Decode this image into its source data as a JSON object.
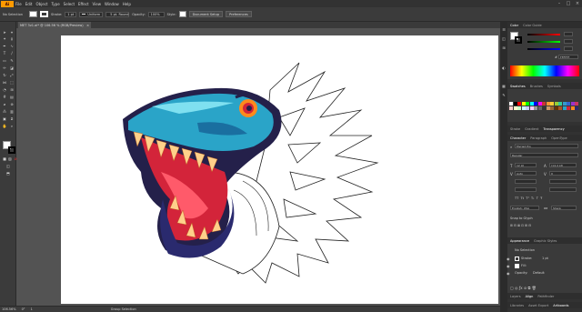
{
  "menubar": {
    "logo": "Ai",
    "items": [
      "File",
      "Edit",
      "Object",
      "Type",
      "Select",
      "Effect",
      "View",
      "Window",
      "Help"
    ]
  },
  "control_bar": {
    "selection": "No Selection",
    "stroke_label": "Stroke:",
    "stroke_value": "1 pt",
    "brush_profile": "Uniform",
    "brush_def": "5 pt. Round",
    "opacity_label": "Opacity:",
    "opacity_value": "100%",
    "style_label": "Style:",
    "document_setup": "Document Setup",
    "preferences": "Preferences"
  },
  "document_tab": {
    "title": "MET 3v1.ai* @ 106.56 % (RGB/Preview)",
    "close": "×"
  },
  "status_bar": {
    "zoom": "106.56%",
    "rotate": "0°",
    "artboard": "1",
    "tool": "Group Selection"
  },
  "color_panel": {
    "tabs": [
      "Color",
      "Color Guide"
    ],
    "hex": "FFFFFF"
  },
  "swatches_panel": {
    "tabs": [
      "Swatches",
      "Brushes",
      "Symbols"
    ]
  },
  "stroke_panel": {
    "tabs": [
      "Stroke",
      "Gradient",
      "Transparency"
    ]
  },
  "character_panel": {
    "tabs": [
      "Character",
      "Paragraph",
      "OpenType"
    ],
    "font": "Myriad Pro",
    "style": "Regular",
    "size": "12 pt",
    "leading": "(14.4 pt)",
    "kerning": "Auto",
    "tracking": "0",
    "language": "English: USA",
    "aa": "Sharp",
    "snap": "Snap to Glyph"
  },
  "appearance_panel": {
    "tabs": [
      "Appearance",
      "Graphic Styles"
    ],
    "no_selection": "No Selection",
    "stroke_label": "Stroke:",
    "stroke_value": "1 pt",
    "fill_label": "Fill:",
    "opacity_label": "Opacity:",
    "opacity_value": "Default"
  },
  "bottom_tabs": {
    "row1": [
      "Layers",
      "Align",
      "Pathfinder"
    ],
    "row2": [
      "Libraries",
      "Asset Export",
      "Artboards"
    ]
  },
  "colors": {
    "accent": "#ff9a00",
    "teal": "#2aa4c8",
    "navy": "#2a2a6e",
    "red": "#d3243a",
    "orange": "#ff8a1c"
  }
}
